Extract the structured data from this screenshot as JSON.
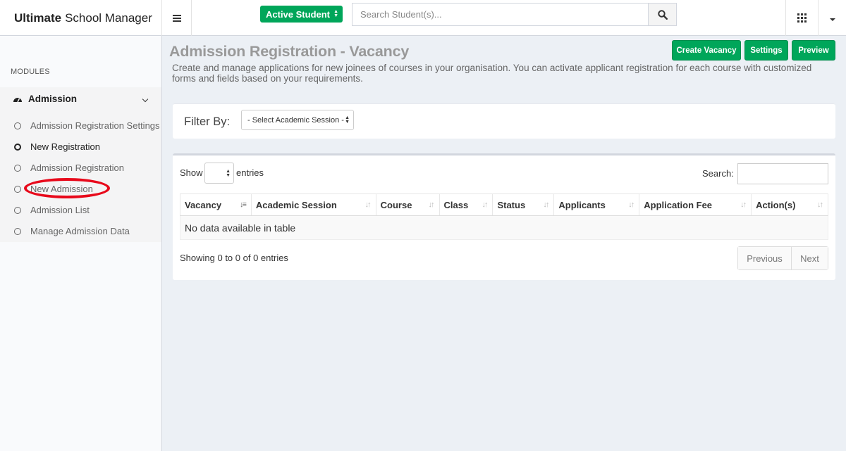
{
  "header": {
    "brand_bold": "Ultimate",
    "brand_rest": "School Manager",
    "student_filter": "Active Student",
    "search_placeholder": "Search Student(s)..."
  },
  "sidebar": {
    "modules_label": "MODULES",
    "section_title": "Admission",
    "items": [
      {
        "label": "Admission Registration Settings",
        "active": false
      },
      {
        "label": "New Registration",
        "active": true
      },
      {
        "label": "Admission Registration",
        "active": false
      },
      {
        "label": "New Admission",
        "active": false,
        "highlighted": true
      },
      {
        "label": "Admission List",
        "active": false
      },
      {
        "label": "Manage Admission Data",
        "active": false
      }
    ]
  },
  "page": {
    "title": "Admission Registration - Vacancy",
    "description": "Create and manage applications for new joinees of courses in your organisation. You can activate applicant registration for each course with customized forms and fields based on your requirements.",
    "buttons": {
      "create_vacancy": "Create Vacancy",
      "settings": "Settings",
      "preview": "Preview"
    }
  },
  "filter": {
    "label": "Filter By:",
    "session_placeholder": "- Select Academic Session -"
  },
  "table": {
    "show_label": "Show",
    "entries_label": "entries",
    "search_label": "Search:",
    "columns": [
      "Vacancy",
      "Academic Session",
      "Course",
      "Class",
      "Status",
      "Applicants",
      "Application Fee",
      "Action(s)"
    ],
    "empty_message": "No data available in table",
    "info": "Showing 0 to 0 of 0 entries",
    "pager": {
      "previous": "Previous",
      "next": "Next"
    }
  },
  "colors": {
    "accent_green": "#00a65a",
    "highlight_red": "#e8091b"
  }
}
